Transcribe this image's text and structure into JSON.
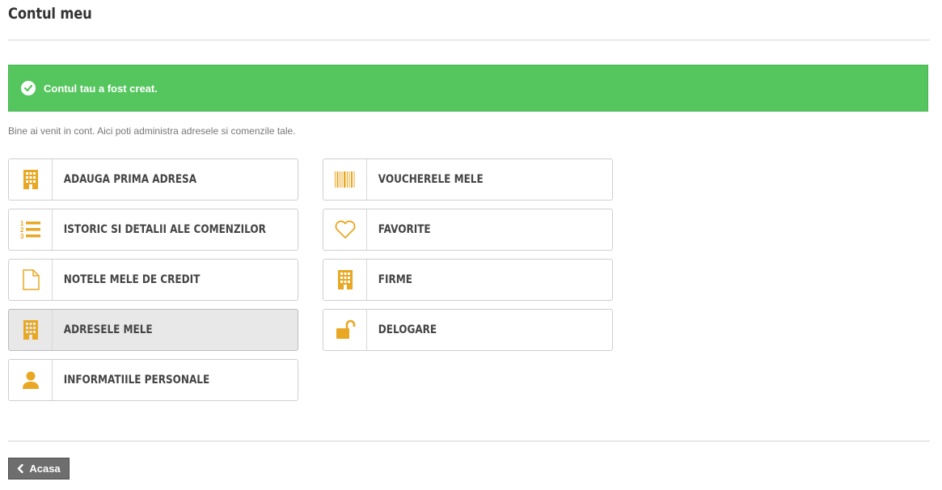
{
  "page": {
    "title": "Contul meu"
  },
  "alert": {
    "message": "Contul tau a fost creat.",
    "color": "#55c65e"
  },
  "welcome": {
    "text": "Bine ai venit in cont. Aici poti administra adresele si comenzile tale."
  },
  "theme": {
    "accent": "#e8a823"
  },
  "menu": {
    "left": [
      {
        "label": "ADAUGA PRIMA ADRESA",
        "icon": "building-icon"
      },
      {
        "label": "ISTORIC SI DETALII ALE COMENZILOR",
        "icon": "numbered-list-icon"
      },
      {
        "label": "NOTELE MELE DE CREDIT",
        "icon": "document-icon"
      },
      {
        "label": "ADRESELE MELE",
        "icon": "building-icon",
        "active": true
      },
      {
        "label": "INFORMATIILE PERSONALE",
        "icon": "user-icon"
      }
    ],
    "right": [
      {
        "label": "VOUCHERELE MELE",
        "icon": "barcode-icon"
      },
      {
        "label": "FAVORITE",
        "icon": "heart-icon"
      },
      {
        "label": "FIRME",
        "icon": "building-icon"
      },
      {
        "label": "DELOGARE",
        "icon": "unlock-icon"
      }
    ]
  },
  "footer": {
    "back_label": "Acasa",
    "back_icon": "chevron-left-icon"
  }
}
